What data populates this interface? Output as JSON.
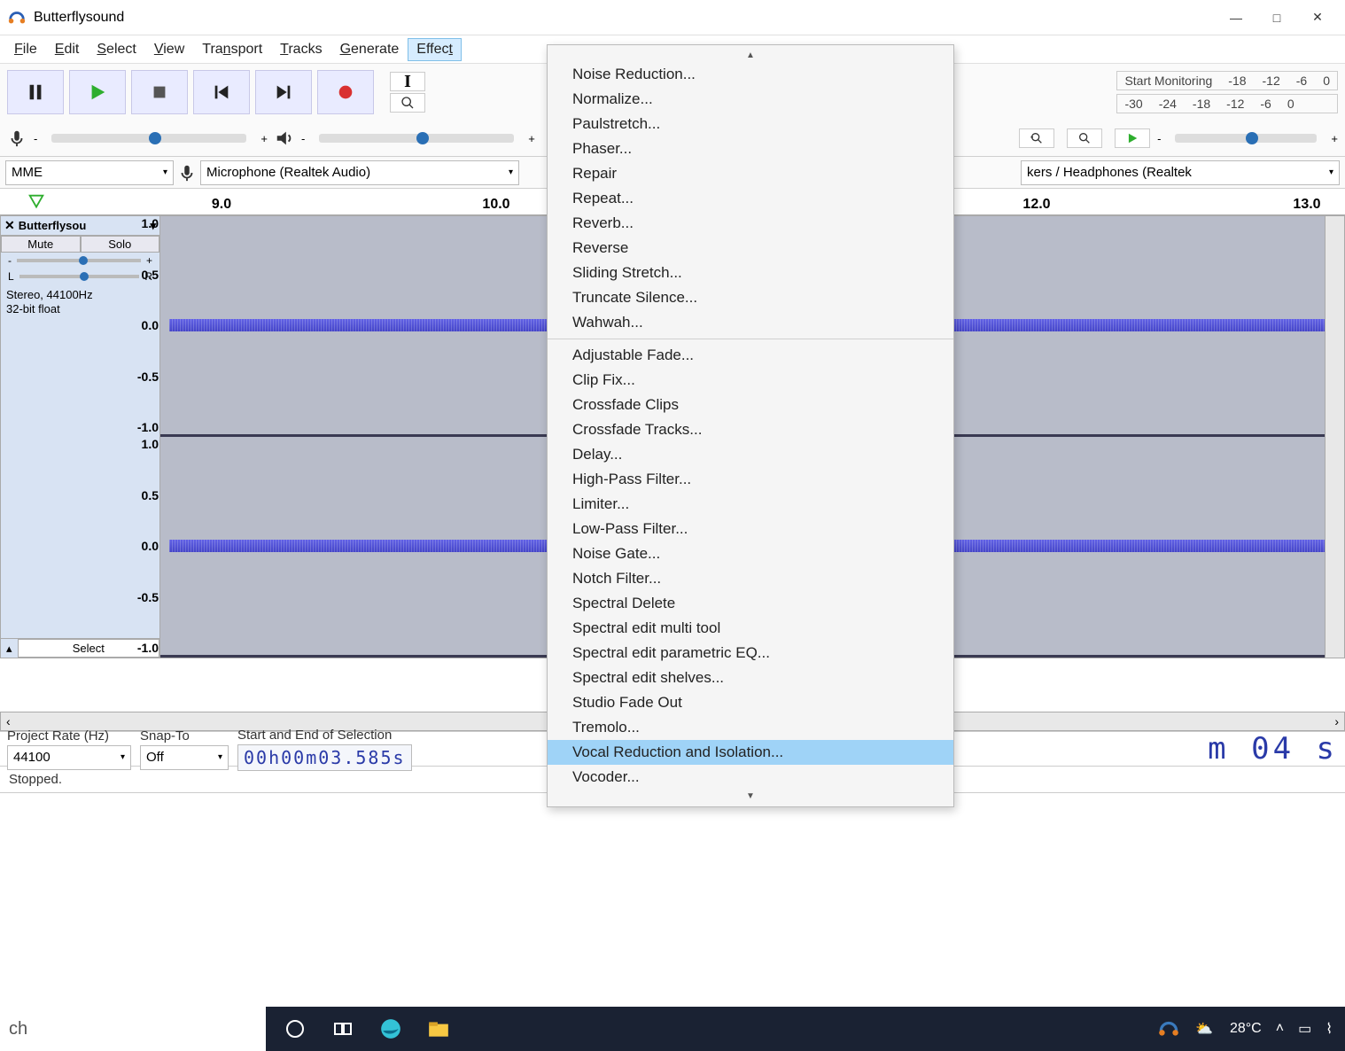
{
  "window": {
    "title": "Butterflysound",
    "min": "—",
    "max": "□",
    "close": "✕"
  },
  "menubar": {
    "file_u": "F",
    "file": "ile",
    "edit_u": "E",
    "edit": "dit",
    "select_u": "S",
    "select": "elect",
    "view_u": "V",
    "view": "iew",
    "transport_u": "T",
    "transport_r": "ra",
    "transport_n": "n",
    "transport_end": "sport",
    "tracks_u": "T",
    "tracks": "racks",
    "generate_u": "G",
    "generate": "enerate",
    "effect_u": "t",
    "effect_pre": "Effec"
  },
  "meters": {
    "monitoring": "Start Monitoring",
    "ticks_top": [
      "-18",
      "-12",
      "-6",
      "0"
    ],
    "ticks_bot": [
      "-30",
      "-24",
      "-18",
      "-12",
      "-6",
      "0"
    ]
  },
  "devices": {
    "host": "MME",
    "input": "Microphone (Realtek Audio)",
    "output": "kers / Headphones (Realtek"
  },
  "ruler": {
    "t1": "9.0",
    "t2": "10.0",
    "t3": "12.0",
    "t4": "13.0"
  },
  "track": {
    "name": "Butterflysou",
    "mute": "Mute",
    "solo": "Solo",
    "left": "L",
    "right": "R",
    "minus": "-",
    "plus": "+",
    "info1": "Stereo, 44100Hz",
    "info2": "32-bit float",
    "select_btn": "Select",
    "scale": [
      "1.0",
      "0.5",
      "0.0",
      "-0.5",
      "-1.0"
    ]
  },
  "selection": {
    "rate_label": "Project Rate (Hz)",
    "snap_label": "Snap-To",
    "range_label": "Start and End of Selection",
    "rate_value": "44100",
    "snap_value": "Off",
    "start_time": "00h00m03.585s",
    "big_time": "m 04 s"
  },
  "status": {
    "text": "Stopped."
  },
  "effect_menu": {
    "items": [
      "Noise Reduction...",
      "Normalize...",
      "Paulstretch...",
      "Phaser...",
      "Repair",
      "Repeat...",
      "Reverb...",
      "Reverse",
      "Sliding Stretch...",
      "Truncate Silence...",
      "Wahwah..."
    ],
    "items2": [
      "Adjustable Fade...",
      "Clip Fix...",
      "Crossfade Clips",
      "Crossfade Tracks...",
      "Delay...",
      "High-Pass Filter...",
      "Limiter...",
      "Low-Pass Filter...",
      "Noise Gate...",
      "Notch Filter...",
      "Spectral Delete",
      "Spectral edit multi tool",
      "Spectral edit parametric EQ...",
      "Spectral edit shelves...",
      "Studio Fade Out",
      "Tremolo..."
    ],
    "highlight": "Vocal Reduction and Isolation...",
    "items3": [
      "Vocoder..."
    ]
  },
  "taskbar": {
    "search": "ch",
    "temp": "28°C"
  }
}
